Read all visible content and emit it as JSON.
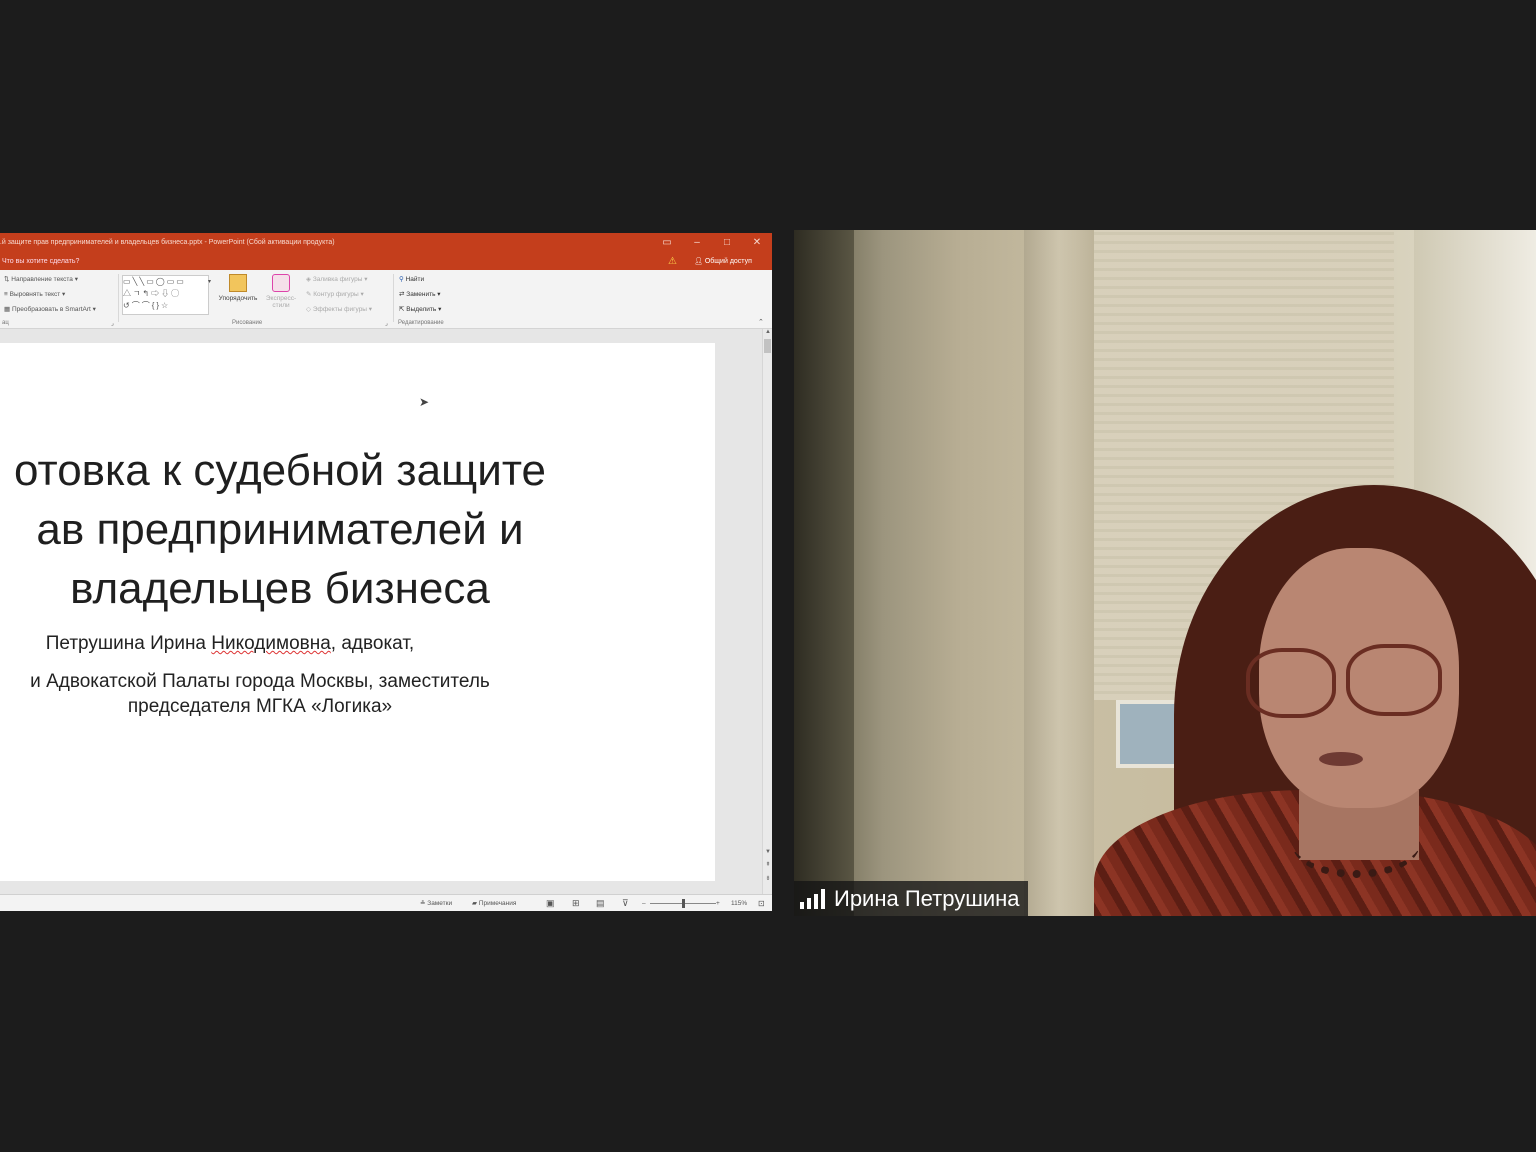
{
  "ppt": {
    "window_title": "...й защите прав предпринимателей и владельцев бизнеса.pptx - PowerPoint (Сбой активации продукта)",
    "tell_me": "Что вы хотите сделать?",
    "share_button": "Общий доступ",
    "ribbon": {
      "text_direction": "Направление текста",
      "align_text": "Выровнять текст",
      "smartart": "Преобразовать в SmartArt",
      "arrange": "Упорядочить",
      "quick_styles": "Экспресс-стили",
      "shape_fill": "Заливка фигуры",
      "shape_outline": "Контур фигуры",
      "shape_effects": "Эффекты фигуры",
      "find": "Найти",
      "replace": "Заменить",
      "select": "Выделить",
      "group_drawing": "Рисование",
      "group_editing": "Редактирование",
      "group_paragraph": "ац"
    },
    "slide": {
      "title_line1": "отовка к судебной защите",
      "title_line2": "ав предпринимателей и",
      "title_line3": "владельцев бизнеса",
      "author_name": "Петрушина Ирина ",
      "author_patronymic": "Никодимовна",
      "author_role": ", адвокат,",
      "affiliation_line1": "и Адвокатской Палаты города Москвы, заместитель",
      "affiliation_line2": "председателя МГКА «Логика»"
    },
    "status": {
      "notes": "Заметки",
      "comments": "Примечания",
      "zoom": "115%"
    }
  },
  "participant": {
    "name": "Ирина Петрушина"
  },
  "colors": {
    "ppt_accent": "#c43e1c",
    "background": "#1c1c1c"
  }
}
